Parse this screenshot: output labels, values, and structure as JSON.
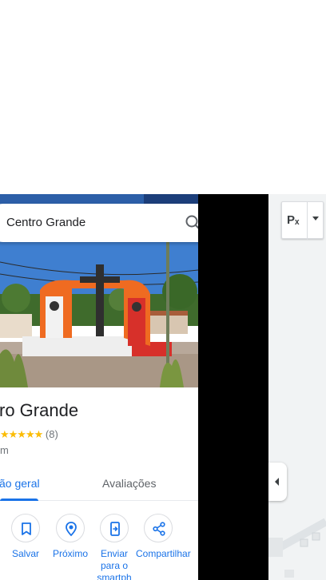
{
  "search": {
    "query": "Centro Grande"
  },
  "place": {
    "title": "ro Grande",
    "stars": "★★★★★",
    "review_count": "(8)",
    "distance": "m"
  },
  "tabs": [
    {
      "label": "ão geral",
      "active": true
    },
    {
      "label": "Avaliações",
      "active": false
    }
  ],
  "actions": [
    {
      "label": "Salvar",
      "icon": "bookmark-icon"
    },
    {
      "label": "Próximo",
      "icon": "nearby-icon"
    },
    {
      "label": "Enviar para o smartph",
      "icon": "send-to-phone-icon"
    },
    {
      "label": "Compartilhar",
      "icon": "share-icon"
    }
  ],
  "map_controls": {
    "layer_label": "Pₓ"
  },
  "colors": {
    "accent": "#1a73e8",
    "star": "#fbbc04",
    "text_secondary": "#70757a"
  }
}
